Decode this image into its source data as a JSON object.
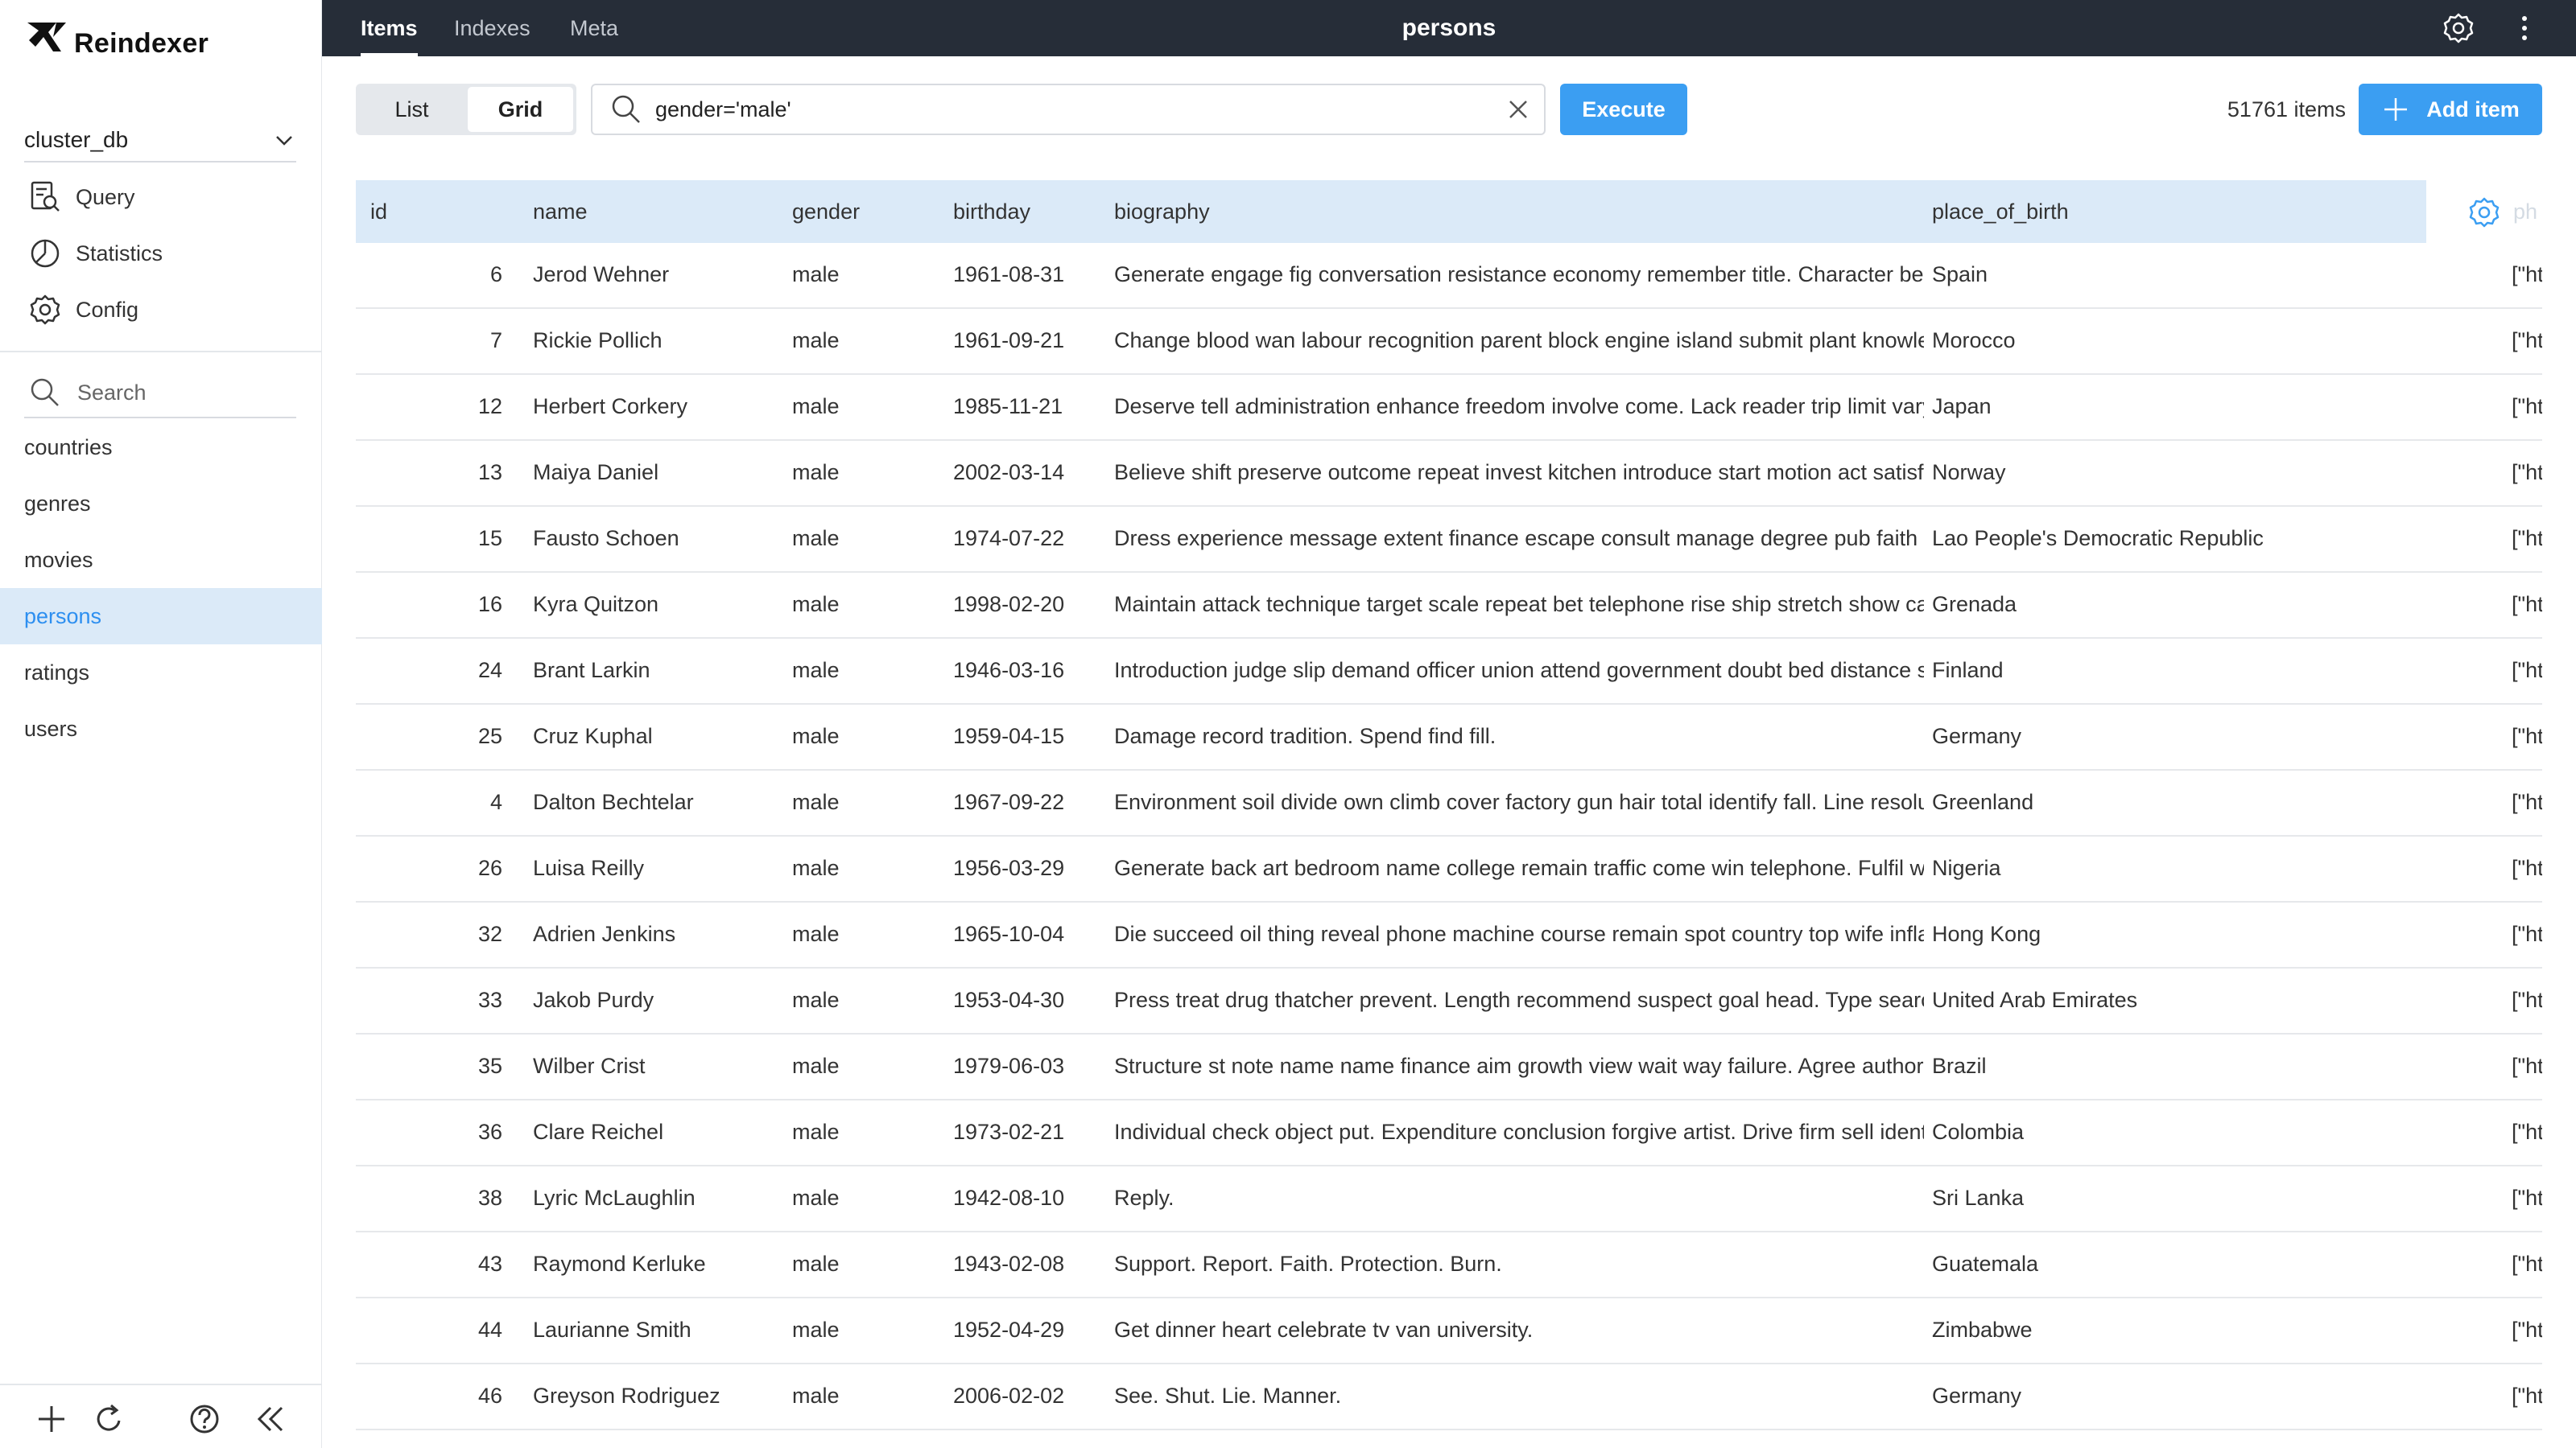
{
  "app": {
    "name": "Reindexer",
    "database": "cluster_db"
  },
  "sidebar": {
    "nav": [
      {
        "label": "Query",
        "icon": "query-icon"
      },
      {
        "label": "Statistics",
        "icon": "statistics-icon"
      },
      {
        "label": "Config",
        "icon": "config-gear-icon"
      }
    ],
    "search_placeholder": "Search",
    "namespaces": [
      "countries",
      "genres",
      "movies",
      "persons",
      "ratings",
      "users"
    ],
    "active_namespace": "persons"
  },
  "topbar": {
    "tabs": [
      "Items",
      "Indexes",
      "Meta"
    ],
    "active_tab": "Items",
    "title": "persons"
  },
  "toolbar": {
    "view_list": "List",
    "view_grid": "Grid",
    "active_view": "Grid",
    "query": "gender='male'",
    "execute_label": "Execute",
    "items_count": "51761 items",
    "add_label": "Add item"
  },
  "table": {
    "columns": [
      "id",
      "name",
      "gender",
      "birthday",
      "biography",
      "place_of_birth"
    ],
    "ghost_column": "ph",
    "rows": [
      {
        "id": "6",
        "name": "Jerod Wehner",
        "gender": "male",
        "birthday": "1961-08-31",
        "biography": "Generate engage fig conversation resistance economy remember title. Character bear",
        "place_of_birth": "Spain",
        "photo": "[\"ht"
      },
      {
        "id": "7",
        "name": "Rickie Pollich",
        "gender": "male",
        "birthday": "1961-09-21",
        "biography": "Change blood wan labour recognition parent block engine island submit plant knowled",
        "place_of_birth": "Morocco",
        "photo": "[\"ht"
      },
      {
        "id": "12",
        "name": "Herbert Corkery",
        "gender": "male",
        "birthday": "1985-11-21",
        "biography": "Deserve tell administration enhance freedom involve come. Lack reader trip limit vary to",
        "place_of_birth": "Japan",
        "photo": "[\"ht"
      },
      {
        "id": "13",
        "name": "Maiya Daniel",
        "gender": "male",
        "birthday": "2002-03-14",
        "biography": "Believe shift preserve outcome repeat invest kitchen introduce start motion act satisfy",
        "place_of_birth": "Norway",
        "photo": "[\"ht"
      },
      {
        "id": "15",
        "name": "Fausto Schoen",
        "gender": "male",
        "birthday": "1974-07-22",
        "biography": "Dress experience message extent finance escape consult manage degree pub faith stri",
        "place_of_birth": "Lao People's Democratic Republic",
        "photo": "[\"ht"
      },
      {
        "id": "16",
        "name": "Kyra Quitzon",
        "gender": "male",
        "birthday": "1998-02-20",
        "biography": "Maintain attack technique target scale repeat bet telephone rise ship stretch show cau",
        "place_of_birth": "Grenada",
        "photo": "[\"ht"
      },
      {
        "id": "24",
        "name": "Brant Larkin",
        "gender": "male",
        "birthday": "1946-03-16",
        "biography": "Introduction judge slip demand officer union attend government doubt bed distance sh",
        "place_of_birth": "Finland",
        "photo": "[\"ht"
      },
      {
        "id": "25",
        "name": "Cruz Kuphal",
        "gender": "male",
        "birthday": "1959-04-15",
        "biography": "Damage record tradition. Spend find fill.",
        "place_of_birth": "Germany",
        "photo": "[\"ht"
      },
      {
        "id": "4",
        "name": "Dalton Bechtelar",
        "gender": "male",
        "birthday": "1967-09-22",
        "biography": "Environment soil divide own climb cover factory gun hair total identify fall. Line resolutic",
        "place_of_birth": "Greenland",
        "photo": "[\"ht"
      },
      {
        "id": "26",
        "name": "Luisa Reilly",
        "gender": "male",
        "birthday": "1956-03-29",
        "biography": "Generate back art bedroom name college remain traffic come win telephone. Fulfil wea",
        "place_of_birth": "Nigeria",
        "photo": "[\"ht"
      },
      {
        "id": "32",
        "name": "Adrien Jenkins",
        "gender": "male",
        "birthday": "1965-10-04",
        "biography": "Die succeed oil thing reveal phone machine course remain spot country top wife inflatic",
        "place_of_birth": "Hong Kong",
        "photo": "[\"ht"
      },
      {
        "id": "33",
        "name": "Jakob Purdy",
        "gender": "male",
        "birthday": "1953-04-30",
        "biography": "Press treat drug thatcher prevent. Length recommend suspect goal head. Type search",
        "place_of_birth": "United Arab Emirates",
        "photo": "[\"ht"
      },
      {
        "id": "35",
        "name": "Wilber Crist",
        "gender": "male",
        "birthday": "1979-06-03",
        "biography": "Structure st note name name finance aim growth view wait way failure. Agree authority o",
        "place_of_birth": "Brazil",
        "photo": "[\"ht"
      },
      {
        "id": "36",
        "name": "Clare Reichel",
        "gender": "male",
        "birthday": "1973-02-21",
        "biography": "Individual check object put. Expenditure conclusion forgive artist. Drive firm sell identify",
        "place_of_birth": "Colombia",
        "photo": "[\"ht"
      },
      {
        "id": "38",
        "name": "Lyric McLaughlin",
        "gender": "male",
        "birthday": "1942-08-10",
        "biography": "Reply.",
        "place_of_birth": "Sri Lanka",
        "photo": "[\"ht"
      },
      {
        "id": "43",
        "name": "Raymond Kerluke",
        "gender": "male",
        "birthday": "1943-02-08",
        "biography": "Support. Report. Faith. Protection. Burn.",
        "place_of_birth": "Guatemala",
        "photo": "[\"ht"
      },
      {
        "id": "44",
        "name": "Laurianne Smith",
        "gender": "male",
        "birthday": "1952-04-29",
        "biography": "Get dinner heart celebrate tv van university.",
        "place_of_birth": "Zimbabwe",
        "photo": "[\"ht"
      },
      {
        "id": "46",
        "name": "Greyson Rodriguez",
        "gender": "male",
        "birthday": "2006-02-02",
        "biography": "See. Shut. Lie. Manner.",
        "place_of_birth": "Germany",
        "photo": "[\"ht"
      }
    ]
  },
  "colors": {
    "accent": "#3b9ef2",
    "topbar": "#262d38",
    "header_bg": "#dbeaf8",
    "active_text": "#2d8ff0"
  }
}
